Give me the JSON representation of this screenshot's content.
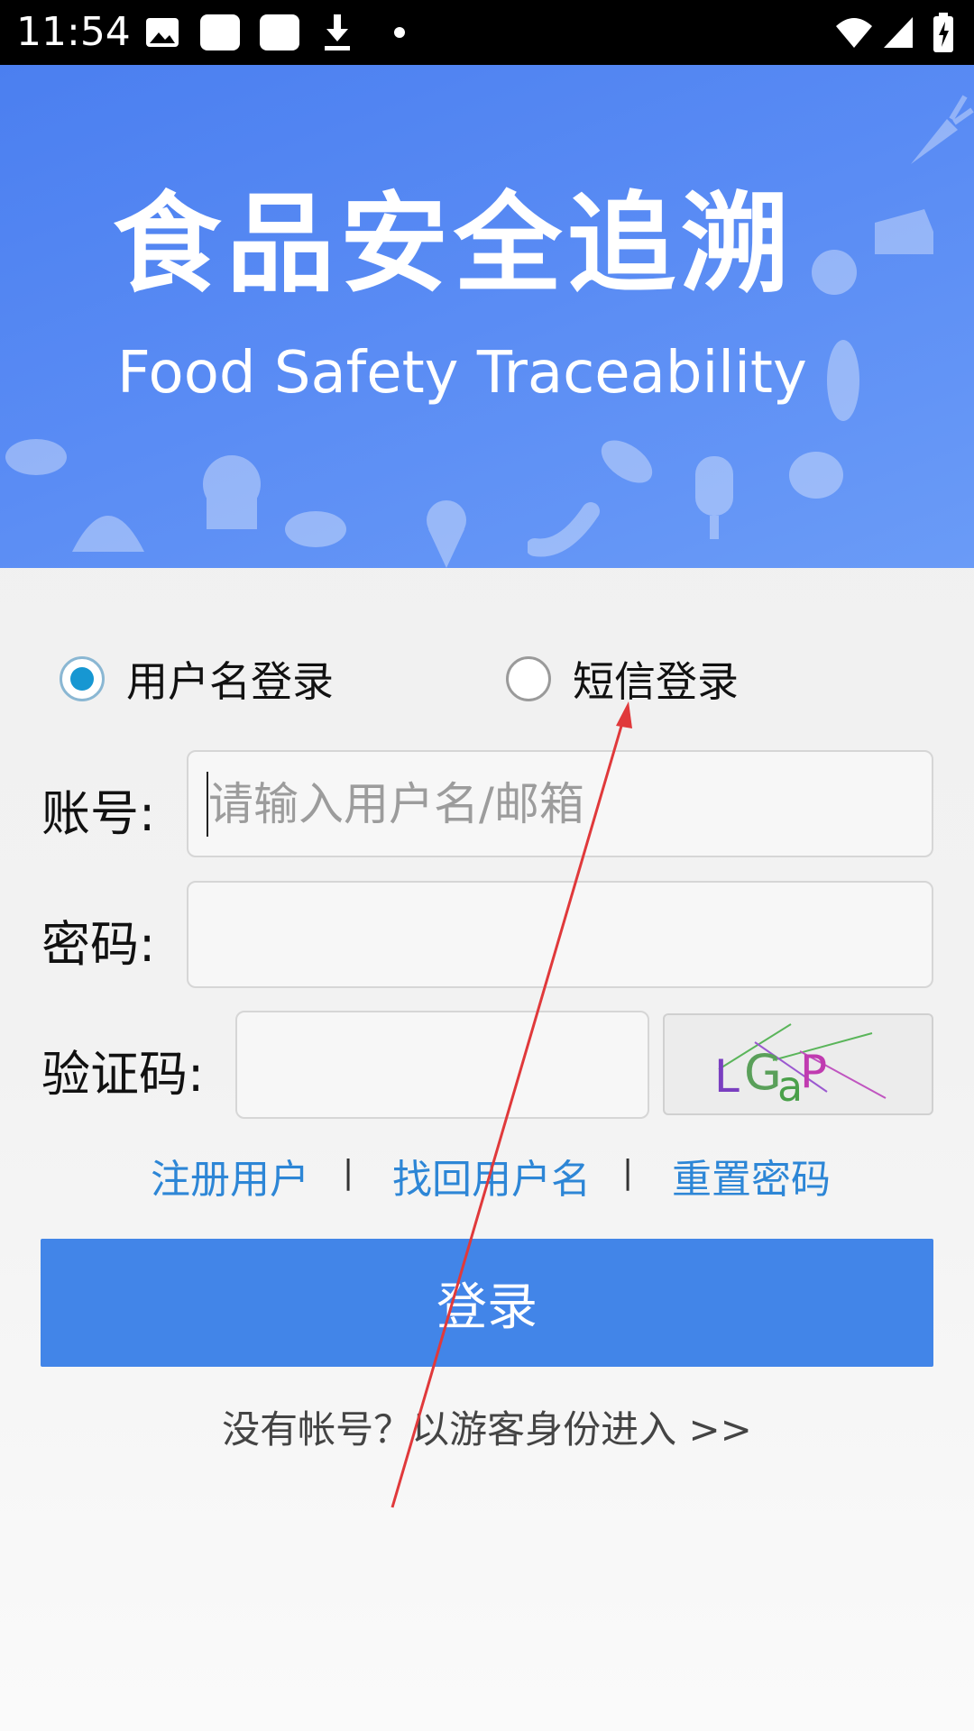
{
  "status_bar": {
    "time": "11:54",
    "icons": [
      "image-icon",
      "notification-box-icon",
      "notification-box-icon",
      "download-icon",
      "dot-icon",
      "wifi-icon",
      "signal-icon",
      "battery-charging-icon"
    ]
  },
  "banner": {
    "title": "食品安全追溯",
    "subtitle": "Food Safety Traceability",
    "background_color": "#5a8cf4"
  },
  "login_mode": {
    "options": [
      {
        "label": "用户名登录",
        "selected": true
      },
      {
        "label": "短信登录",
        "selected": false
      }
    ]
  },
  "form": {
    "account_label": "账号:",
    "account_placeholder": "请输入用户名/邮箱",
    "account_value": "",
    "password_label": "密码:",
    "password_value": "",
    "captcha_label": "验证码:",
    "captcha_value": "",
    "captcha_image_text": "LGaP"
  },
  "links": {
    "register": "注册用户",
    "separator": "|",
    "recover_username": "找回用户名",
    "reset_password": "重置密码"
  },
  "login_button": "登录",
  "guest_entry": "没有帐号？以游客身份进入 >>",
  "colors": {
    "accent": "#4285e8",
    "link": "#2d86d6",
    "radio_selected": "#1797d2",
    "annotation_arrow": "#e0393b"
  }
}
